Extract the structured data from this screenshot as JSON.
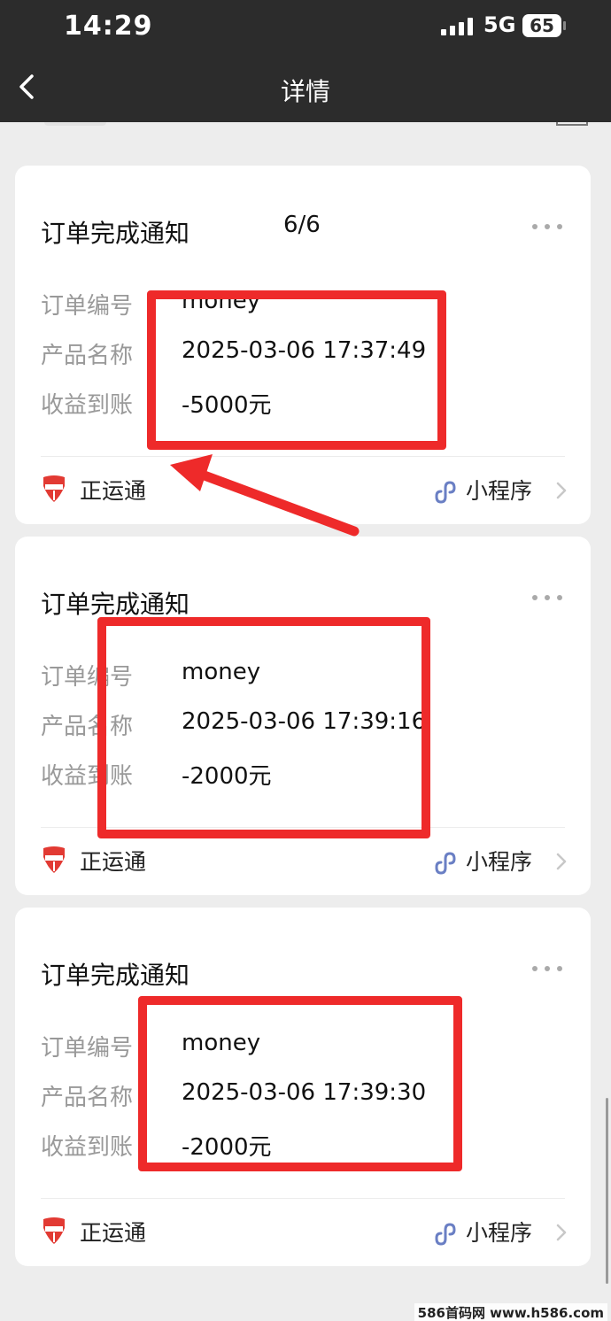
{
  "status_bar": {
    "time": "14:29",
    "network": "5G",
    "battery": "65"
  },
  "nav": {
    "title": "详情"
  },
  "cards": [
    {
      "title": "订单完成通知",
      "counter": "6/6",
      "rows": [
        {
          "label": "订单编号",
          "value": "money"
        },
        {
          "label": "产品名称",
          "value": "2025-03-06 17:37:49"
        },
        {
          "label": "收益到账",
          "value": "-5000元"
        }
      ],
      "brand": "正运通",
      "mini_program": "小程序"
    },
    {
      "title": "订单完成通知",
      "rows": [
        {
          "label": "订单编号",
          "value": "money"
        },
        {
          "label": "产品名称",
          "value": "2025-03-06 17:39:16"
        },
        {
          "label": "收益到账",
          "value": "-2000元"
        }
      ],
      "brand": "正运通",
      "mini_program": "小程序"
    },
    {
      "title": "订单完成通知",
      "rows": [
        {
          "label": "订单编号",
          "value": "money"
        },
        {
          "label": "产品名称",
          "value": "2025-03-06 17:39:30"
        },
        {
          "label": "收益到账",
          "value": "-2000元"
        }
      ],
      "brand": "正运通",
      "mini_program": "小程序"
    }
  ],
  "icons": [
    "signal-icon",
    "battery-icon",
    "back-icon",
    "more-icon",
    "brand-logo-icon",
    "mini-program-icon",
    "chevron-right-icon"
  ],
  "colors": {
    "highlight": "#ee2a2a",
    "header_bg": "#2c2c2c",
    "page_bg": "#ededed",
    "label": "#999999"
  },
  "watermark": "586首码网 www.h586.com"
}
